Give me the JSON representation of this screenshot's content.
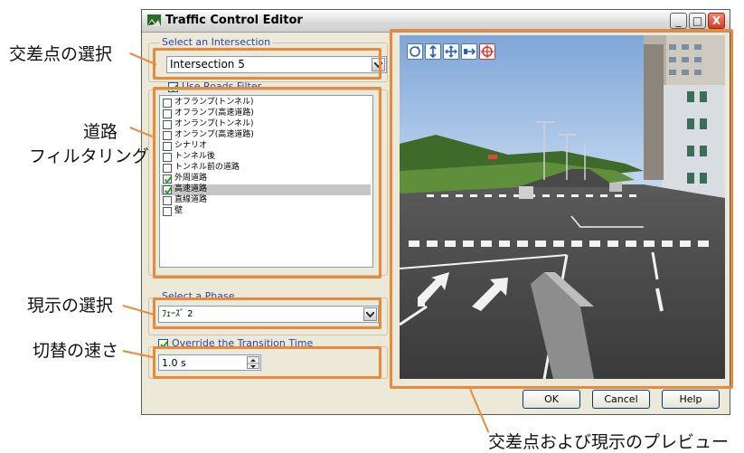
{
  "window": {
    "title": "Traffic Control Editor",
    "min_label": "_",
    "max_label": "□",
    "close_label": "X"
  },
  "intersection": {
    "group_label": "Select an Intersection",
    "selected": "Intersection 5"
  },
  "roads_filter": {
    "checkbox_label": "Use Roads Filter",
    "checked": true,
    "items": [
      {
        "label": "オフランプ(トンネル)",
        "checked": false,
        "selected": false
      },
      {
        "label": "オフランプ(高速道路)",
        "checked": false,
        "selected": false
      },
      {
        "label": "オンランプ(トンネル)",
        "checked": false,
        "selected": false
      },
      {
        "label": "オンランプ(高速道路)",
        "checked": false,
        "selected": false
      },
      {
        "label": "シナリオ",
        "checked": false,
        "selected": false
      },
      {
        "label": "トンネル後",
        "checked": false,
        "selected": false
      },
      {
        "label": "トンネル前の道路",
        "checked": false,
        "selected": false
      },
      {
        "label": "外周道路",
        "checked": true,
        "selected": false
      },
      {
        "label": "高速道路",
        "checked": true,
        "selected": true
      },
      {
        "label": "直線道路",
        "checked": false,
        "selected": false
      },
      {
        "label": "壁",
        "checked": false,
        "selected": false
      }
    ]
  },
  "phase": {
    "group_label": "Select a Phase",
    "selected": "ﾌｪｰｽﾞ 2"
  },
  "transition": {
    "checkbox_label": "Override the Transition Time",
    "checked": true,
    "value": "1.0 s"
  },
  "buttons": {
    "ok": "OK",
    "cancel": "Cancel",
    "help": "Help"
  },
  "preview_tools": [
    "rotate-view-icon",
    "move-up-down-icon",
    "pan-icon",
    "dolly-icon",
    "reset-view-icon"
  ],
  "callouts": {
    "intersection": "交差点の選択",
    "filter_line1": "道路",
    "filter_line2": "フィルタリング",
    "phase": "現示の選択",
    "speed": "切替の速さ",
    "preview": "交差点および現示のプレビュー"
  },
  "colors": {
    "highlight": "#e98a3a",
    "group_label": "#2b46a8"
  }
}
